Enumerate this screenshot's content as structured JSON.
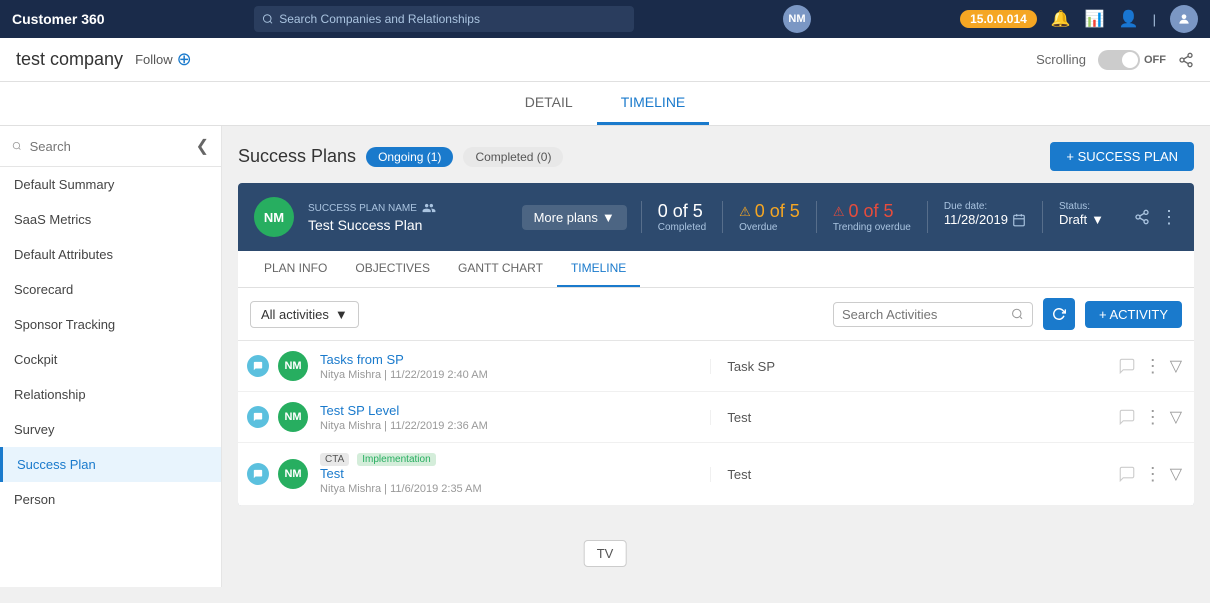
{
  "topnav": {
    "title": "Customer 360",
    "search_placeholder": "Search Companies and Relationships",
    "version": "15.0.0.014",
    "user_initials": "NM"
  },
  "company_header": {
    "company_name": "test company",
    "follow_label": "Follow",
    "scrolling_label": "Scrolling",
    "scrolling_state": "OFF"
  },
  "main_tabs": [
    {
      "id": "detail",
      "label": "DETAIL",
      "active": false
    },
    {
      "id": "timeline",
      "label": "TIMELINE",
      "active": false
    }
  ],
  "sidebar": {
    "search_placeholder": "Search",
    "items": [
      {
        "id": "default-summary",
        "label": "Default Summary",
        "active": false
      },
      {
        "id": "saas-metrics",
        "label": "SaaS Metrics",
        "active": false
      },
      {
        "id": "default-attributes",
        "label": "Default Attributes",
        "active": false
      },
      {
        "id": "scorecard",
        "label": "Scorecard",
        "active": false
      },
      {
        "id": "sponsor-tracking",
        "label": "Sponsor Tracking",
        "active": false
      },
      {
        "id": "cockpit",
        "label": "Cockpit",
        "active": false
      },
      {
        "id": "relationship",
        "label": "Relationship",
        "active": false
      },
      {
        "id": "survey",
        "label": "Survey",
        "active": false
      },
      {
        "id": "success-plan",
        "label": "Success Plan",
        "active": true
      },
      {
        "id": "person",
        "label": "Person",
        "active": false
      }
    ]
  },
  "success_plans": {
    "title": "Success Plans",
    "tabs": [
      {
        "id": "ongoing",
        "label": "Ongoing (1)",
        "active": true
      },
      {
        "id": "completed",
        "label": "Completed (0)",
        "active": false
      }
    ],
    "add_button": "+ SUCCESS PLAN"
  },
  "plan_card": {
    "initials": "NM",
    "plan_name_label": "SUCCESS PLAN NAME",
    "plan_name": "Test Success Plan",
    "more_plans": "More plans",
    "completed_count": "0 of 5",
    "completed_label": "Completed",
    "overdue_count": "0 of 5",
    "overdue_label": "Overdue",
    "trending_count": "0 of 5",
    "trending_label": "Trending overdue",
    "due_date_label": "Due date:",
    "due_date": "11/28/2019",
    "status_label": "Status:",
    "status_value": "Draft"
  },
  "plan_tabs": [
    {
      "id": "plan-info",
      "label": "PLAN INFO",
      "active": false
    },
    {
      "id": "objectives",
      "label": "OBJECTIVES",
      "active": false
    },
    {
      "id": "gantt-chart",
      "label": "GANTT CHART",
      "active": false
    },
    {
      "id": "timeline",
      "label": "TIMELINE",
      "active": true
    }
  ],
  "activities": {
    "filter_label": "All activities",
    "search_placeholder": "Search Activities",
    "add_button": "+ ACTIVITY",
    "items": [
      {
        "id": 1,
        "initials": "NM",
        "title": "Tasks from SP",
        "meta": "Nitya Mishra  |  11/22/2019 2:40 AM",
        "description": "Task SP",
        "cta_badge": null,
        "impl_badge": null
      },
      {
        "id": 2,
        "initials": "NM",
        "title": "Test SP Level",
        "meta": "Nitya Mishra  |  11/22/2019 2:36 AM",
        "description": "Test",
        "cta_badge": null,
        "impl_badge": null
      },
      {
        "id": 3,
        "initials": "NM",
        "title": "Test",
        "meta": "Nitya Mishra  |  11/6/2019 2:35 AM",
        "description": "Test",
        "cta_badge": "CTA",
        "impl_badge": "Implementation"
      }
    ]
  },
  "tv_button": "TV"
}
